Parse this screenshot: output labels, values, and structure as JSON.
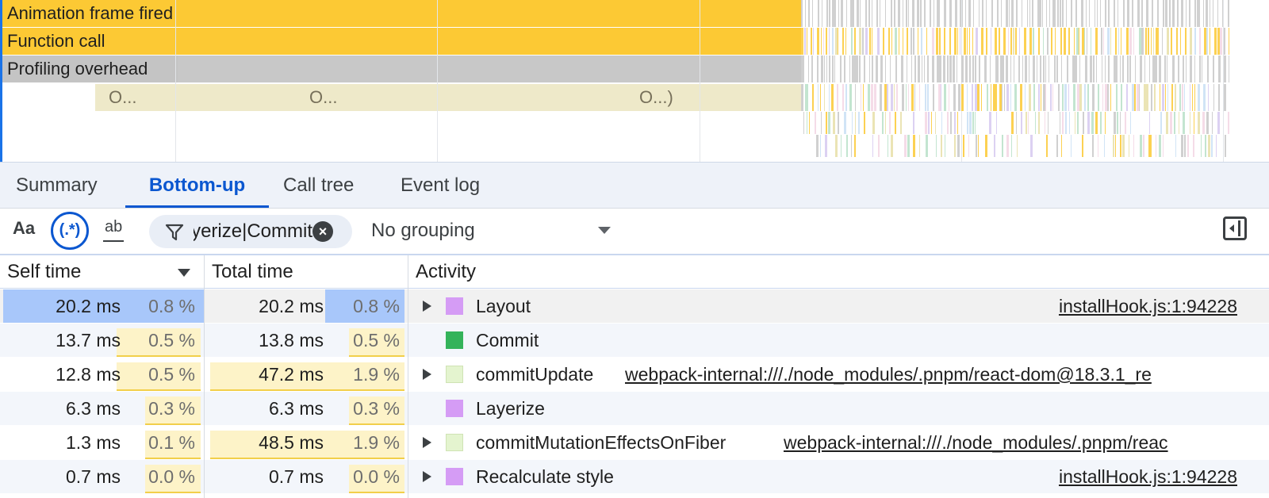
{
  "flame": {
    "tracks": [
      {
        "label": "Animation frame fired",
        "kind": "yellow"
      },
      {
        "label": "Function call",
        "kind": "yellow"
      },
      {
        "label": "Profiling overhead",
        "kind": "gray"
      }
    ],
    "olive_labels": [
      "O...",
      "O...",
      "O...)"
    ]
  },
  "tabs": [
    {
      "label": "Summary",
      "active": false
    },
    {
      "label": "Bottom-up",
      "active": true
    },
    {
      "label": "Call tree",
      "active": false
    },
    {
      "label": "Event log",
      "active": false
    }
  ],
  "toolbar": {
    "match_case_label": "Aa",
    "regex_label": "(.*)",
    "whole_word_label": "ab",
    "filter_value": "Layerize|Commit",
    "grouping_value": "No grouping"
  },
  "table": {
    "headers": {
      "self": "Self time",
      "total": "Total time",
      "activity": "Activity"
    },
    "rows": [
      {
        "self_ms": "20.2 ms",
        "self_pct": "0.8 %",
        "total_ms": "20.2 ms",
        "total_pct": "0.8 %",
        "activity": "Layout",
        "source": "installHook.js:1:94228",
        "swatch": "#d59cf5",
        "expandable": true,
        "selected": true
      },
      {
        "self_ms": "13.7 ms",
        "self_pct": "0.5 %",
        "total_ms": "13.8 ms",
        "total_pct": "0.5 %",
        "activity": "Commit",
        "source": "",
        "swatch": "#34b35a",
        "expandable": false,
        "selected": false
      },
      {
        "self_ms": "12.8 ms",
        "self_pct": "0.5 %",
        "total_ms": "47.2 ms",
        "total_pct": "1.9 %",
        "activity": "commitUpdate",
        "source": "webpack-internal:///./node_modules/.pnpm/react-dom@18.3.1_re",
        "swatch": "#e4f4cf",
        "expandable": true,
        "selected": false
      },
      {
        "self_ms": "6.3 ms",
        "self_pct": "0.3 %",
        "total_ms": "6.3 ms",
        "total_pct": "0.3 %",
        "activity": "Layerize",
        "source": "",
        "swatch": "#d59cf5",
        "expandable": false,
        "selected": false
      },
      {
        "self_ms": "1.3 ms",
        "self_pct": "0.1 %",
        "total_ms": "48.5 ms",
        "total_pct": "1.9 %",
        "activity": "commitMutationEffectsOnFiber",
        "source": "webpack-internal:///./node_modules/.pnpm/reac",
        "swatch": "#e4f4cf",
        "expandable": true,
        "selected": false
      },
      {
        "self_ms": "0.7 ms",
        "self_pct": "0.0 %",
        "total_ms": "0.7 ms",
        "total_pct": "0.0 %",
        "activity": "Recalculate style",
        "source": "installHook.js:1:94228",
        "swatch": "#d59cf5",
        "expandable": true,
        "selected": false
      }
    ]
  },
  "colors": {
    "accent": "#0b57d0",
    "flame_yellow": "#fcc934",
    "flame_gray": "#c4c4c4",
    "self_bar": "#fdf3c8",
    "self_bar_line": "#f2cf4a",
    "selected_cell": "#a8c7fa"
  },
  "icons": {
    "filter": "filter-funnel-icon",
    "clear": "clear-circle-icon",
    "dropdown": "chevron-down-icon",
    "sidebar": "sidebar-toggle-icon",
    "sort": "sort-descending-icon",
    "expand": "triangle-right-icon"
  }
}
